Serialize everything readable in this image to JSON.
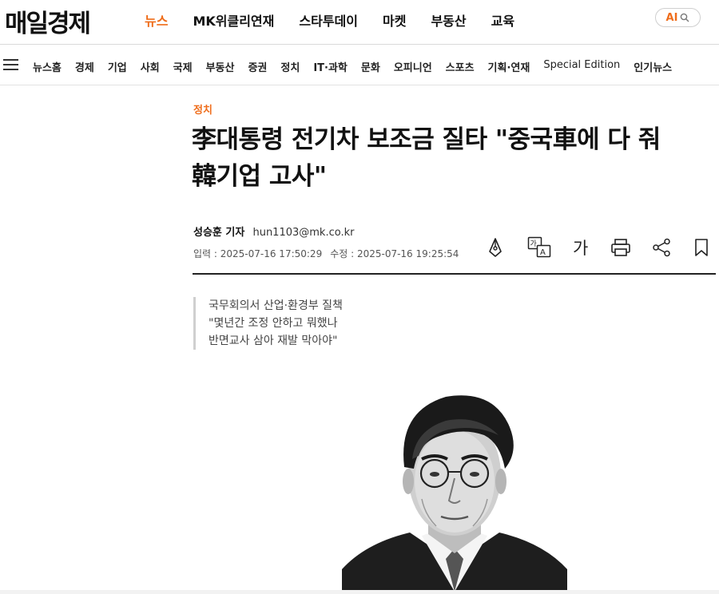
{
  "header": {
    "logo": "매일경제",
    "nav": [
      {
        "label": "뉴스",
        "active": true
      },
      {
        "label": "MK위클리연재",
        "active": false
      },
      {
        "label": "스타투데이",
        "active": false
      },
      {
        "label": "마켓",
        "active": false
      },
      {
        "label": "부동산",
        "active": false
      },
      {
        "label": "교육",
        "active": false
      }
    ],
    "ai_button": {
      "label": "AI",
      "icon": "search-icon"
    },
    "accent_color": "#ef6d1b"
  },
  "categories": {
    "menu_icon": "hamburger-menu-icon",
    "items": [
      "뉴스홈",
      "경제",
      "기업",
      "사회",
      "국제",
      "부동산",
      "증권",
      "정치",
      "IT·과학",
      "문화",
      "오피니언",
      "스포츠",
      "기획·연재",
      "Special Edition",
      "인기뉴스"
    ]
  },
  "article": {
    "section": "정치",
    "headline_line1": "李대통령 전기차 보조금 질타 \"중국車에 다 줘",
    "headline_line2": "韓기업 고사\"",
    "reporter": "성승훈 기자",
    "email": "hun1103@mk.co.kr",
    "published_label": "입력 : 2025-07-16 17:50:29",
    "updated_label": "수정 : 2025-07-16 19:25:54",
    "tools": [
      {
        "name": "ai-pen-icon"
      },
      {
        "name": "translate-icon"
      },
      {
        "name": "font-size-icon",
        "text": "가"
      },
      {
        "name": "print-icon"
      },
      {
        "name": "share-icon"
      },
      {
        "name": "bookmark-icon"
      }
    ],
    "summary": [
      "국무회의서 산업·환경부 질책",
      "\"몇년간 조정 안하고 뭐했나",
      "반면교사 삼아 재발 막아야\""
    ],
    "photo": "president-portrait-illustration"
  }
}
